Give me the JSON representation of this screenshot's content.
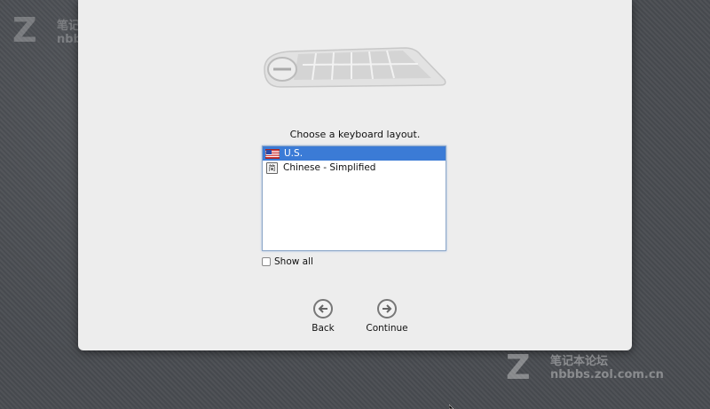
{
  "setup": {
    "prompt": "Choose a keyboard layout.",
    "layouts": [
      {
        "label": "U.S.",
        "icon": "us-flag-icon",
        "selected": true
      },
      {
        "label": "Chinese - Simplified",
        "icon": "input-method-icon",
        "icon_glyph": "简",
        "selected": false
      }
    ],
    "show_all_label": "Show all",
    "show_all_checked": false,
    "back_label": "Back",
    "continue_label": "Continue",
    "selection_color": "#3b7bd6"
  },
  "watermark": {
    "logo_letter": "Z",
    "title": "笔记本论坛",
    "url": "nbbbs.zol.com.cn"
  }
}
